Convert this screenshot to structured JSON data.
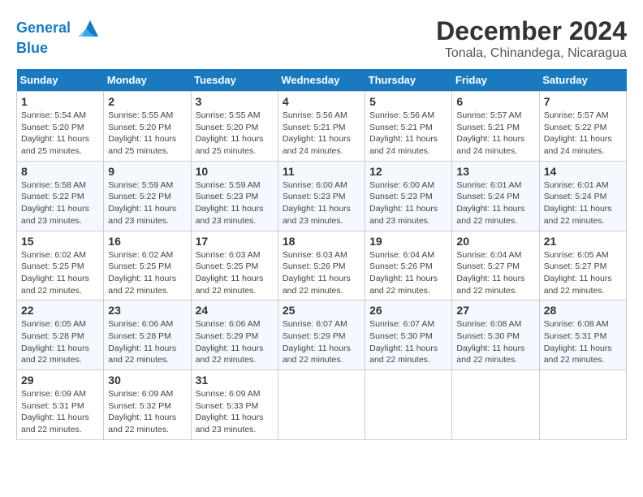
{
  "header": {
    "logo_line1": "General",
    "logo_line2": "Blue",
    "month_title": "December 2024",
    "location": "Tonala, Chinandega, Nicaragua"
  },
  "days_of_week": [
    "Sunday",
    "Monday",
    "Tuesday",
    "Wednesday",
    "Thursday",
    "Friday",
    "Saturday"
  ],
  "weeks": [
    [
      {
        "day": 1,
        "sunrise": "5:54 AM",
        "sunset": "5:20 PM",
        "daylight": "11 hours and 25 minutes"
      },
      {
        "day": 2,
        "sunrise": "5:55 AM",
        "sunset": "5:20 PM",
        "daylight": "11 hours and 25 minutes"
      },
      {
        "day": 3,
        "sunrise": "5:55 AM",
        "sunset": "5:20 PM",
        "daylight": "11 hours and 25 minutes"
      },
      {
        "day": 4,
        "sunrise": "5:56 AM",
        "sunset": "5:21 PM",
        "daylight": "11 hours and 24 minutes"
      },
      {
        "day": 5,
        "sunrise": "5:56 AM",
        "sunset": "5:21 PM",
        "daylight": "11 hours and 24 minutes"
      },
      {
        "day": 6,
        "sunrise": "5:57 AM",
        "sunset": "5:21 PM",
        "daylight": "11 hours and 24 minutes"
      },
      {
        "day": 7,
        "sunrise": "5:57 AM",
        "sunset": "5:22 PM",
        "daylight": "11 hours and 24 minutes"
      }
    ],
    [
      {
        "day": 8,
        "sunrise": "5:58 AM",
        "sunset": "5:22 PM",
        "daylight": "11 hours and 23 minutes"
      },
      {
        "day": 9,
        "sunrise": "5:59 AM",
        "sunset": "5:22 PM",
        "daylight": "11 hours and 23 minutes"
      },
      {
        "day": 10,
        "sunrise": "5:59 AM",
        "sunset": "5:23 PM",
        "daylight": "11 hours and 23 minutes"
      },
      {
        "day": 11,
        "sunrise": "6:00 AM",
        "sunset": "5:23 PM",
        "daylight": "11 hours and 23 minutes"
      },
      {
        "day": 12,
        "sunrise": "6:00 AM",
        "sunset": "5:23 PM",
        "daylight": "11 hours and 23 minutes"
      },
      {
        "day": 13,
        "sunrise": "6:01 AM",
        "sunset": "5:24 PM",
        "daylight": "11 hours and 22 minutes"
      },
      {
        "day": 14,
        "sunrise": "6:01 AM",
        "sunset": "5:24 PM",
        "daylight": "11 hours and 22 minutes"
      }
    ],
    [
      {
        "day": 15,
        "sunrise": "6:02 AM",
        "sunset": "5:25 PM",
        "daylight": "11 hours and 22 minutes"
      },
      {
        "day": 16,
        "sunrise": "6:02 AM",
        "sunset": "5:25 PM",
        "daylight": "11 hours and 22 minutes"
      },
      {
        "day": 17,
        "sunrise": "6:03 AM",
        "sunset": "5:25 PM",
        "daylight": "11 hours and 22 minutes"
      },
      {
        "day": 18,
        "sunrise": "6:03 AM",
        "sunset": "5:26 PM",
        "daylight": "11 hours and 22 minutes"
      },
      {
        "day": 19,
        "sunrise": "6:04 AM",
        "sunset": "5:26 PM",
        "daylight": "11 hours and 22 minutes"
      },
      {
        "day": 20,
        "sunrise": "6:04 AM",
        "sunset": "5:27 PM",
        "daylight": "11 hours and 22 minutes"
      },
      {
        "day": 21,
        "sunrise": "6:05 AM",
        "sunset": "5:27 PM",
        "daylight": "11 hours and 22 minutes"
      }
    ],
    [
      {
        "day": 22,
        "sunrise": "6:05 AM",
        "sunset": "5:28 PM",
        "daylight": "11 hours and 22 minutes"
      },
      {
        "day": 23,
        "sunrise": "6:06 AM",
        "sunset": "5:28 PM",
        "daylight": "11 hours and 22 minutes"
      },
      {
        "day": 24,
        "sunrise": "6:06 AM",
        "sunset": "5:29 PM",
        "daylight": "11 hours and 22 minutes"
      },
      {
        "day": 25,
        "sunrise": "6:07 AM",
        "sunset": "5:29 PM",
        "daylight": "11 hours and 22 minutes"
      },
      {
        "day": 26,
        "sunrise": "6:07 AM",
        "sunset": "5:30 PM",
        "daylight": "11 hours and 22 minutes"
      },
      {
        "day": 27,
        "sunrise": "6:08 AM",
        "sunset": "5:30 PM",
        "daylight": "11 hours and 22 minutes"
      },
      {
        "day": 28,
        "sunrise": "6:08 AM",
        "sunset": "5:31 PM",
        "daylight": "11 hours and 22 minutes"
      }
    ],
    [
      {
        "day": 29,
        "sunrise": "6:09 AM",
        "sunset": "5:31 PM",
        "daylight": "11 hours and 22 minutes"
      },
      {
        "day": 30,
        "sunrise": "6:09 AM",
        "sunset": "5:32 PM",
        "daylight": "11 hours and 22 minutes"
      },
      {
        "day": 31,
        "sunrise": "6:09 AM",
        "sunset": "5:33 PM",
        "daylight": "11 hours and 23 minutes"
      },
      null,
      null,
      null,
      null
    ]
  ]
}
